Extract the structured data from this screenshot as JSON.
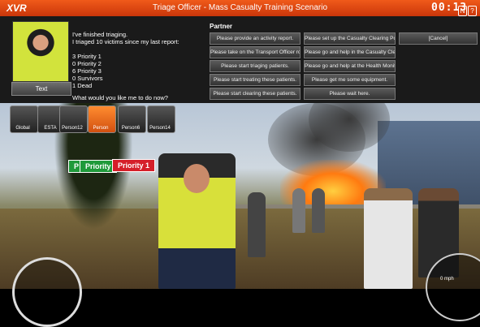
{
  "app": {
    "logo": "XVR",
    "title": "Triage Officer - Mass Casualty Training Scenario",
    "clock": "00:13"
  },
  "top_icons": [
    "N",
    "?",
    "X"
  ],
  "message": {
    "lines": [
      "I've finished triaging.",
      "I triaged 10 victims since my last report:",
      "",
      "3 Priority 1",
      "0 Priority 2",
      "6 Priority 3",
      "0 Survivors",
      "1 Dead"
    ],
    "prompt": "What would you like me to do now?"
  },
  "text_button": "Text",
  "partner": {
    "title": "Partner",
    "actions": [
      "Please provide an activity report.",
      "Please set up the Casualty Clearing Post.",
      "[Cancel]",
      "Please take on the Transport Officer role.",
      "Please go and help in the Casualty Clearing Post",
      "Please start triaging patients.",
      "Please go and help at the Health Monitoring Post",
      "Please start treating these patients.",
      "Please get me some equipment.",
      "Please start clearing these patients.",
      "Please wait here."
    ]
  },
  "person_bar": [
    {
      "label": "Global",
      "icon": "speech-bubble-icon"
    },
    {
      "label": "ESTA",
      "icon": "radio-icon"
    },
    {
      "label": "Person12",
      "icon": "person-icon"
    },
    {
      "label": "Person",
      "icon": "person-icon",
      "active": true
    },
    {
      "label": "Person6",
      "icon": "person-icon"
    },
    {
      "label": "Person14",
      "icon": "person-icon"
    }
  ],
  "tags": [
    {
      "label": "P",
      "color": "#1f9a3a"
    },
    {
      "label": "Priority",
      "color": "#1f9a3a"
    },
    {
      "label": "Priority 1",
      "color": "#d51f2a"
    }
  ],
  "speed_readout": "0 mph"
}
